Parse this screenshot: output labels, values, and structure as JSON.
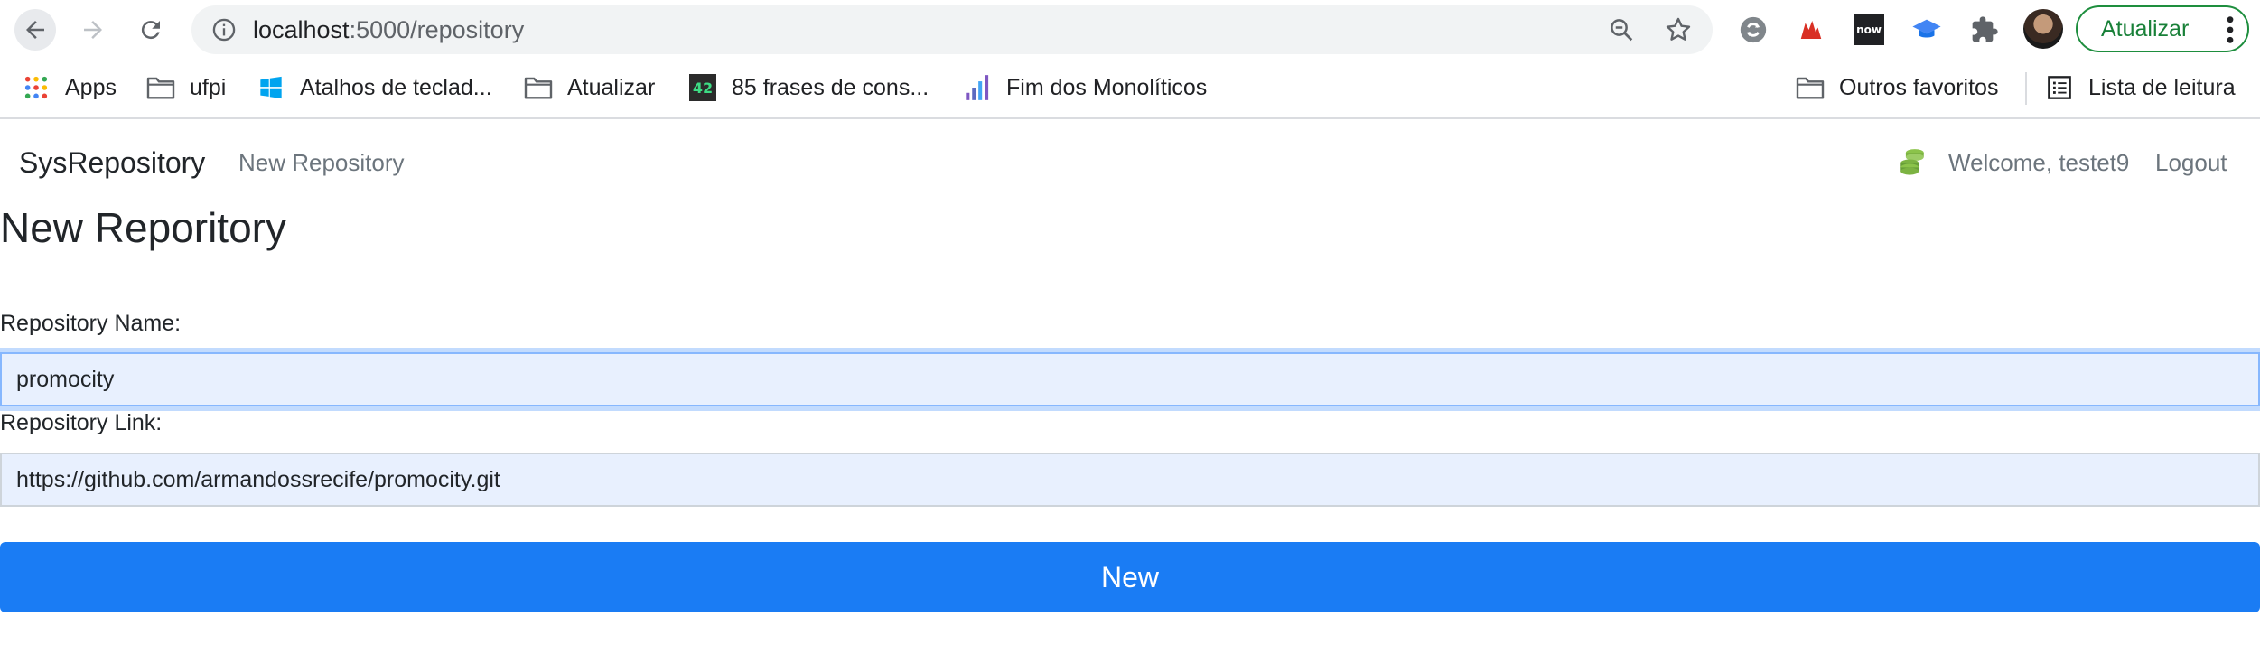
{
  "browser": {
    "url_host": "localhost",
    "url_path": ":5000/repository",
    "update_button_label": "Atualizar",
    "bookmarks": [
      {
        "label": "Apps",
        "icon": "apps-grid-icon"
      },
      {
        "label": "ufpi",
        "icon": "folder-icon"
      },
      {
        "label": "Atalhos de teclad...",
        "icon": "windows-logo-icon"
      },
      {
        "label": "Atualizar",
        "icon": "folder-icon"
      },
      {
        "label": "85 frases de cons...",
        "icon": "42-badge-icon",
        "badge_text": "42"
      },
      {
        "label": "Fim dos Monolíticos",
        "icon": "bar-chart-icon"
      },
      {
        "label": "Outros favoritos",
        "icon": "folder-icon"
      },
      {
        "label": "Lista de leitura",
        "icon": "reading-list-icon"
      }
    ],
    "extensions": [
      "sync-icon",
      "red-extension-icon",
      "now-extension-icon",
      "graduation-cap-icon",
      "puzzle-icon"
    ],
    "now_badge_text": "now"
  },
  "navbar": {
    "brand": "SysRepository",
    "new_repository_link": "New Repository",
    "welcome_text": "Welcome, testet9",
    "logout_link": "Logout"
  },
  "page": {
    "title": "New Reporitory",
    "repo_name_label": "Repository Name:",
    "repo_name_value": "promocity",
    "repo_link_label": "Repository Link:",
    "repo_link_value": "https://github.com/armandossrecife/promocity.git",
    "submit_label": "New"
  },
  "colors": {
    "accent": "#1a7cf4",
    "input_bg": "#e8f0fe",
    "update_green": "#188038"
  }
}
